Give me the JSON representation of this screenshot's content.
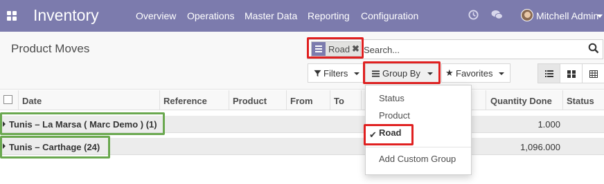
{
  "navbar": {
    "app_title": "Inventory",
    "menu": [
      "Overview",
      "Operations",
      "Master Data",
      "Reporting",
      "Configuration"
    ],
    "user_name": "Mitchell Admin",
    "icons": {
      "apps": "apps-grid-icon",
      "activity": "clock-icon",
      "messages": "chat-icon"
    }
  },
  "control_panel": {
    "breadcrumb": "Product Moves",
    "search": {
      "facet_label": "Road",
      "facet_icon": "group-by-icon",
      "placeholder": "Search..."
    },
    "filters_label": "Filters",
    "group_by_label": "Group By",
    "favorites_label": "Favorites",
    "views": [
      "list-view-icon",
      "kanban-view-icon",
      "pivot-view-icon"
    ]
  },
  "list": {
    "columns": [
      "Date",
      "Reference",
      "Product",
      "From",
      "To",
      "Quantity Done",
      "Status"
    ],
    "groups": [
      {
        "label": "Tunis – La Marsa ( Marc Demo ) (1)",
        "quantity": "1.000"
      },
      {
        "label": "Tunis – Carthage (24)",
        "quantity": "1,096.000"
      }
    ]
  },
  "group_by_dropdown": {
    "items": [
      "Status",
      "Product",
      "Road"
    ],
    "selected": "Road",
    "add_custom": "Add Custom Group"
  },
  "colors": {
    "navbar": "#7c7bad",
    "highlight_red": "#e02020",
    "highlight_green": "#6aa84f"
  }
}
